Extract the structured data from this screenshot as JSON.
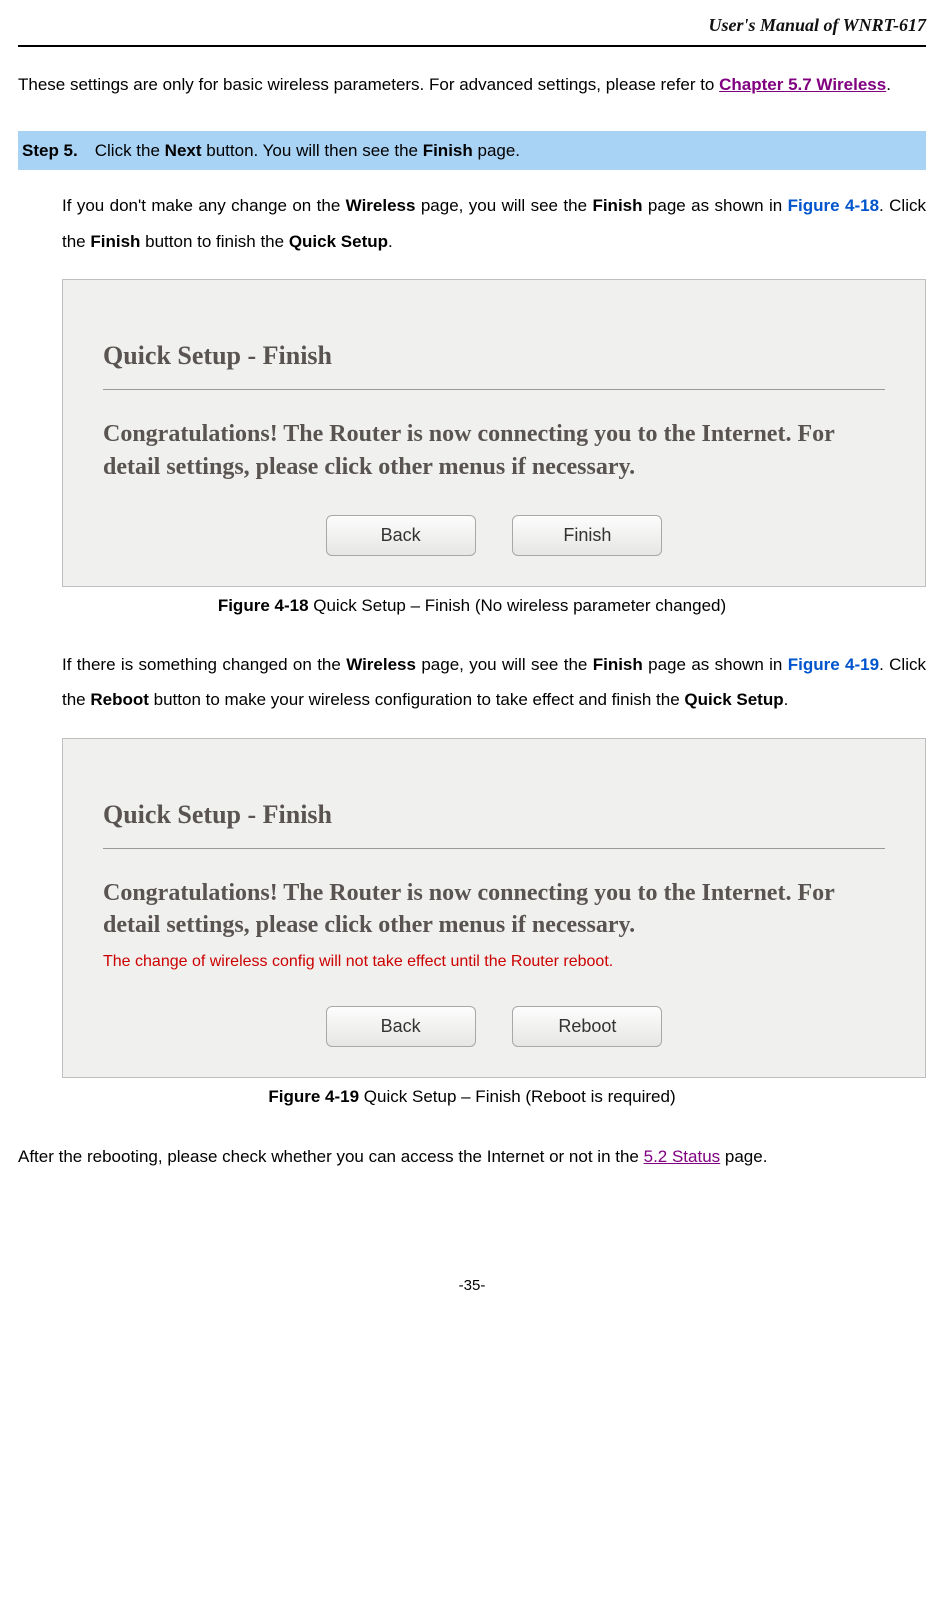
{
  "header": "User's  Manual  of  WNRT-617",
  "intro": {
    "text1": "These settings are only for basic wireless parameters. For advanced settings, please refer to ",
    "link1": "Chapter 5.7 Wireless",
    "text2": "."
  },
  "step": {
    "label": "Step 5.",
    "text1": "Click the ",
    "bold1": "Next",
    "text2": " button. You will then see the ",
    "bold2": "Finish",
    "text3": " page."
  },
  "para1": {
    "t1": "If you don't make any change on the ",
    "b1": "Wireless",
    "t2": " page, you will see the ",
    "b2": "Finish",
    "t3": " page as shown in ",
    "link": "Figure 4-18",
    "t4": ". Click the ",
    "b3": "Finish",
    "t5": " button to finish the ",
    "b4": "Quick Setup",
    "t6": "."
  },
  "fig18": {
    "title": "Quick Setup - Finish",
    "congrats": "Congratulations! The Router is now connecting you to the Internet. For detail settings, please click other menus if necessary.",
    "btn_back": "Back",
    "btn_finish": "Finish",
    "caption_bold": "Figure 4-18",
    "caption_text": "  Quick Setup – Finish (No wireless parameter changed)"
  },
  "para2": {
    "t1": "If there is something changed on the ",
    "b1": "Wireless",
    "t2": " page, you will see the ",
    "b2": "Finish",
    "t3": " page as shown in ",
    "link": "Figure 4-19",
    "t4": ". Click the ",
    "b3": "Reboot",
    "t5": " button to make your wireless configuration to take effect and finish the ",
    "b4": "Quick Setup",
    "t6": "."
  },
  "fig19": {
    "title": "Quick Setup - Finish",
    "congrats": "Congratulations! The Router is now connecting you to the Internet. For detail settings, please click other menus if necessary.",
    "warning": "The change of wireless config will not take effect until the Router reboot.",
    "btn_back": "Back",
    "btn_reboot": "Reboot",
    "caption_bold": "Figure 4-19",
    "caption_text": "  Quick Setup – Finish (Reboot is required)"
  },
  "outro": {
    "t1": "After the rebooting, please check whether you can access the Internet or not in the ",
    "link": "5.2 Status",
    "t2": " page."
  },
  "page_number": "-35-"
}
